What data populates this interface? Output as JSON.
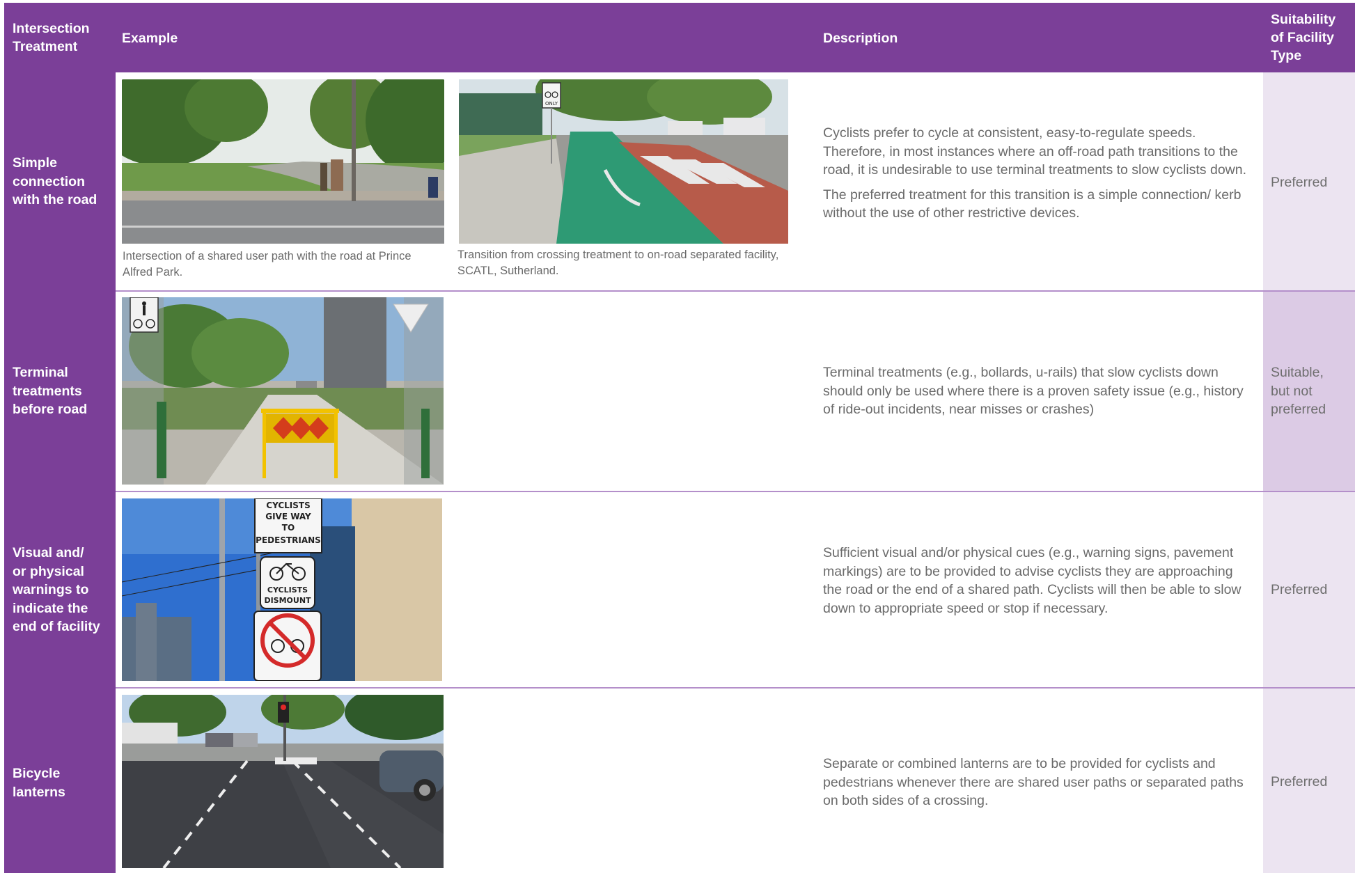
{
  "header": {
    "treatment": "Intersection\nTreatment",
    "example": "Example",
    "description": "Description",
    "suitability": "Suitability\nof Facility\nType"
  },
  "rows": [
    {
      "treatment": "Simple\nconnection\nwith the road",
      "captions": [
        "Intersection of a shared user path with the road at Prince Alfred Park.",
        "Transition from crossing treatment to on-road separated facility, SCATL, Sutherland."
      ],
      "description": [
        "Cyclists prefer to cycle at consistent, easy-to-regulate speeds. Therefore, in most instances where an off-road path transitions to the road, it is undesirable to use terminal treatments to slow cyclists down.",
        "The preferred treatment for this transition is a simple connection/ kerb without the use of other restrictive devices."
      ],
      "suitability": "Preferred"
    },
    {
      "treatment": "Terminal\ntreatments\nbefore road",
      "description": [
        "Terminal treatments (e.g., bollards, u-rails) that slow cyclists down should only be used where there is a proven safety issue (e.g., history of ride-out incidents, near misses or crashes)"
      ],
      "suitability": "Suitable,\nbut not\npreferred"
    },
    {
      "treatment": "Visual and/\nor physical\nwarnings to\nindicate the\nend of facility",
      "description": [
        "Sufficient visual and/or physical cues (e.g., warning signs, pavement markings) are to be provided to advise cyclists they are approaching the road or the end of a shared path. Cyclists will then be able to slow down to appropriate speed or stop if necessary."
      ],
      "suitability": "Preferred",
      "sign_text": {
        "give_way_1": "CYCLISTS",
        "give_way_2": "GIVE WAY",
        "give_way_3": "TO",
        "give_way_4": "PEDESTRIANS",
        "dismount_1": "CYCLISTS",
        "dismount_2": "DISMOUNT"
      }
    },
    {
      "treatment": "Bicycle\nlanterns",
      "description": [
        "Separate or combined lanterns are to be provided for cyclists and pedestrians whenever there are shared user paths or separated paths on both sides of a crossing."
      ],
      "suitability": "Preferred"
    }
  ],
  "photo_text": {
    "only_sign": "ONLY"
  },
  "colors": {
    "header_purple": "#7b3f98",
    "suitability_light": "#ece4f1",
    "suitability_mid": "#dccbe5",
    "divider": "#b48fca",
    "body_text": "#6a6a6a"
  }
}
